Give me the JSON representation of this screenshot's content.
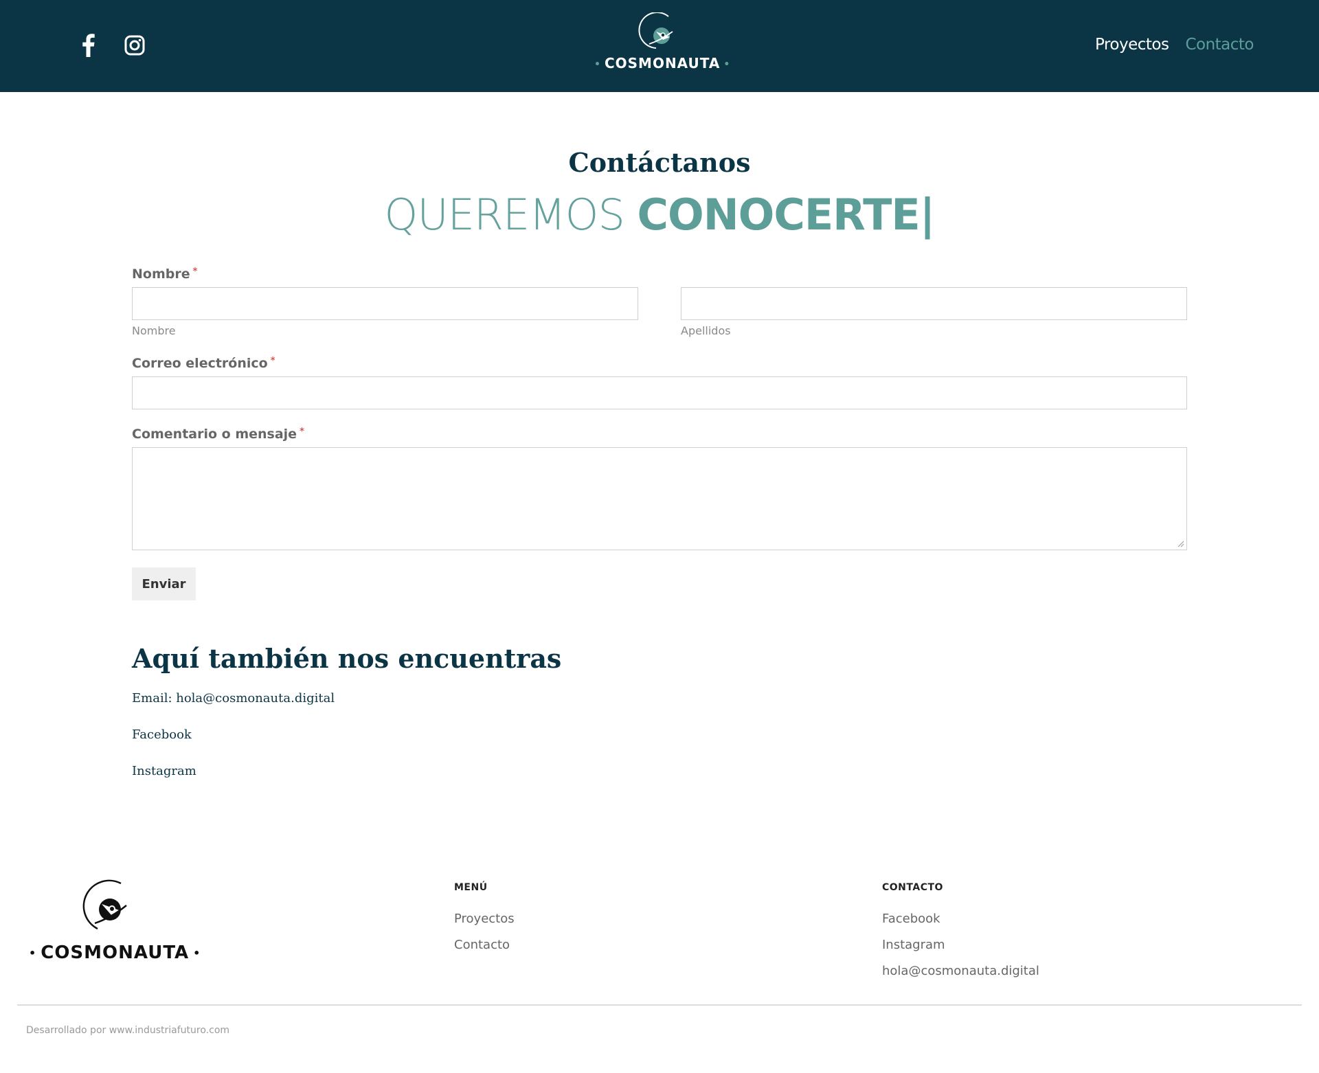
{
  "header": {
    "social": [
      {
        "name": "facebook",
        "icon": "facebook-icon"
      },
      {
        "name": "instagram",
        "icon": "instagram-icon"
      }
    ],
    "brand": "COSMONAUTA",
    "nav": [
      {
        "label": "Proyectos",
        "active": false
      },
      {
        "label": "Contacto",
        "active": true
      }
    ]
  },
  "page": {
    "title": "Contáctanos",
    "hero_light": "QUEREMOS",
    "hero_bold": "CONOCERTE|"
  },
  "form": {
    "name_label": "Nombre",
    "required_mark": "*",
    "first_name_sub": "Nombre",
    "last_name_sub": "Apellidos",
    "email_label": "Correo electrónico",
    "message_label": "Comentario o mensaje",
    "submit_label": "Enviar"
  },
  "also": {
    "title": "Aquí también nos encuentras",
    "email_line": "Email: hola@cosmonauta.digital",
    "facebook": "Facebook",
    "instagram": "Instagram"
  },
  "footer": {
    "brand": "COSMONAUTA",
    "menu_heading": "MENÚ",
    "menu_items": [
      "Proyectos",
      "Contacto"
    ],
    "contact_heading": "CONTACTO",
    "contact_items": [
      "Facebook",
      "Instagram",
      "hola@cosmonauta.digital"
    ],
    "credit": "Desarrollado por www.industriafuturo.com"
  },
  "colors": {
    "header_bg": "#0b3445",
    "accent": "#5d9e98",
    "required": "#d9534f"
  }
}
